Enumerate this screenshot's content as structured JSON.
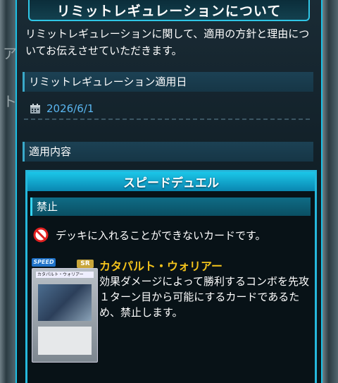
{
  "page": {
    "title": "リミットレギュレーションについて",
    "intro": "リミットレギュレーションに関して、適用の方針と理由についてお伝えさせていただきます。"
  },
  "sections": {
    "date_head": "リミットレギュレーション適用日",
    "date_value": "2026/6/1",
    "content_head": "適用内容"
  },
  "duel": {
    "title": "スピードデュエル",
    "ban_head": "禁止",
    "ban_note": "デッキに入れることができないカードです。",
    "card": {
      "badge": "SPEED",
      "rarity": "SR",
      "name": "カタパルト・ウォリアー",
      "image_name": "カタパルト・ウォリアー",
      "description": "効果ダメージによって勝利するコンボを先攻１ターン目から可能にするカードであるため、禁止します。"
    }
  },
  "colors": {
    "accent": "#25b8dc",
    "date_text": "#5ab6f0",
    "card_name": "#f2c21c",
    "ban_red": "#e02020"
  },
  "icons": [
    "calendar-icon",
    "ban-icon"
  ]
}
